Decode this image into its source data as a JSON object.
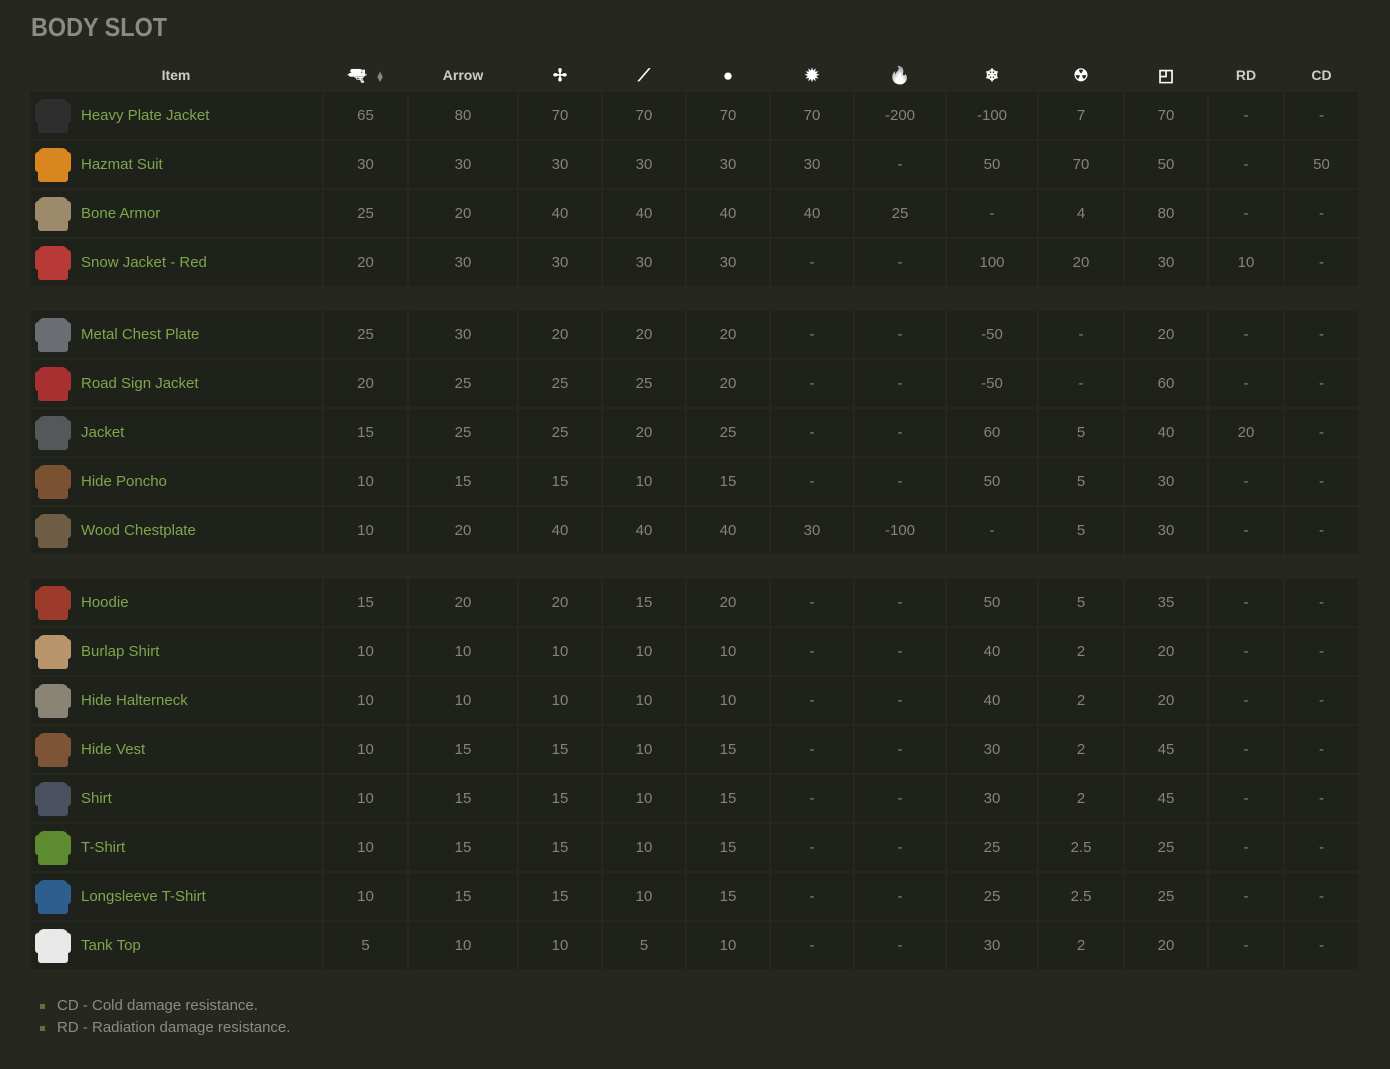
{
  "title": "BODY SLOT",
  "colors": {
    "background": "#262820",
    "cell": "#1f211b",
    "item_name": "#7ea64c",
    "value": "#85847c",
    "header": "#d0ccc4"
  },
  "columns": [
    {
      "label": "Item"
    },
    {
      "icon": "pistol-icon",
      "glyph": "🔫",
      "sortable": true
    },
    {
      "label": "Arrow"
    },
    {
      "icon": "stab-shuriken-icon",
      "glyph": "✢"
    },
    {
      "icon": "slash-knife-icon",
      "glyph": "⟋"
    },
    {
      "icon": "blunt-icon",
      "glyph": "●"
    },
    {
      "icon": "explosion-icon",
      "glyph": "✹"
    },
    {
      "icon": "fire-icon",
      "glyph": "🔥"
    },
    {
      "icon": "cold-snowflake-icon",
      "glyph": "❄"
    },
    {
      "icon": "radiation-icon",
      "glyph": "☢"
    },
    {
      "icon": "bite-icon",
      "glyph": "◰"
    },
    {
      "label": "RD"
    },
    {
      "label": "CD"
    }
  ],
  "groups": [
    [
      {
        "name": "Heavy Plate Jacket",
        "icon_color": "#2e2e2e",
        "values": [
          "65",
          "80",
          "70",
          "70",
          "70",
          "70",
          "-200",
          "-100",
          "7",
          "70",
          "-",
          "-"
        ]
      },
      {
        "name": "Hazmat Suit",
        "icon_color": "#d8861f",
        "values": [
          "30",
          "30",
          "30",
          "30",
          "30",
          "30",
          "-",
          "50",
          "70",
          "50",
          "-",
          "50"
        ]
      },
      {
        "name": "Bone Armor",
        "icon_color": "#9c8a6a",
        "values": [
          "25",
          "20",
          "40",
          "40",
          "40",
          "40",
          "25",
          "-",
          "4",
          "80",
          "-",
          "-"
        ]
      },
      {
        "name": "Snow Jacket - Red",
        "icon_color": "#b83a36",
        "values": [
          "20",
          "30",
          "30",
          "30",
          "30",
          "-",
          "-",
          "100",
          "20",
          "30",
          "10",
          "-"
        ]
      }
    ],
    [
      {
        "name": "Metal Chest Plate",
        "icon_color": "#6a6e72",
        "values": [
          "25",
          "30",
          "20",
          "20",
          "20",
          "-",
          "-",
          "-50",
          "-",
          "20",
          "-",
          "-"
        ]
      },
      {
        "name": "Road Sign Jacket",
        "icon_color": "#a83030",
        "values": [
          "20",
          "25",
          "25",
          "25",
          "20",
          "-",
          "-",
          "-50",
          "-",
          "60",
          "-",
          "-"
        ]
      },
      {
        "name": "Jacket",
        "icon_color": "#55585a",
        "values": [
          "15",
          "25",
          "25",
          "20",
          "25",
          "-",
          "-",
          "60",
          "5",
          "40",
          "20",
          "-"
        ]
      },
      {
        "name": "Hide Poncho",
        "icon_color": "#7a5232",
        "values": [
          "10",
          "15",
          "15",
          "10",
          "15",
          "-",
          "-",
          "50",
          "5",
          "30",
          "-",
          "-"
        ]
      },
      {
        "name": "Wood Chestplate",
        "icon_color": "#6e5c44",
        "values": [
          "10",
          "20",
          "40",
          "40",
          "40",
          "30",
          "-100",
          "-",
          "5",
          "30",
          "-",
          "-"
        ]
      }
    ],
    [
      {
        "name": "Hoodie",
        "icon_color": "#9c3a2c",
        "values": [
          "15",
          "20",
          "20",
          "15",
          "20",
          "-",
          "-",
          "50",
          "5",
          "35",
          "-",
          "-"
        ]
      },
      {
        "name": "Burlap Shirt",
        "icon_color": "#b8956a",
        "values": [
          "10",
          "10",
          "10",
          "10",
          "10",
          "-",
          "-",
          "40",
          "2",
          "20",
          "-",
          "-"
        ]
      },
      {
        "name": "Hide Halterneck",
        "icon_color": "#8a8474",
        "values": [
          "10",
          "10",
          "10",
          "10",
          "10",
          "-",
          "-",
          "40",
          "2",
          "20",
          "-",
          "-"
        ]
      },
      {
        "name": "Hide Vest",
        "icon_color": "#7e5436",
        "values": [
          "10",
          "15",
          "15",
          "10",
          "15",
          "-",
          "-",
          "30",
          "2",
          "45",
          "-",
          "-"
        ]
      },
      {
        "name": "Shirt",
        "icon_color": "#4a5060",
        "values": [
          "10",
          "15",
          "15",
          "10",
          "15",
          "-",
          "-",
          "30",
          "2",
          "45",
          "-",
          "-"
        ]
      },
      {
        "name": "T-Shirt",
        "icon_color": "#5e8a30",
        "values": [
          "10",
          "15",
          "15",
          "10",
          "15",
          "-",
          "-",
          "25",
          "2.5",
          "25",
          "-",
          "-"
        ]
      },
      {
        "name": "Longsleeve T-Shirt",
        "icon_color": "#2e5e8e",
        "values": [
          "10",
          "15",
          "15",
          "10",
          "15",
          "-",
          "-",
          "25",
          "2.5",
          "25",
          "-",
          "-"
        ]
      },
      {
        "name": "Tank Top",
        "icon_color": "#e8e8e8",
        "values": [
          "5",
          "10",
          "10",
          "5",
          "10",
          "-",
          "-",
          "30",
          "2",
          "20",
          "-",
          "-"
        ]
      }
    ]
  ],
  "notes": [
    "CD - Cold damage resistance.",
    "RD - Radiation damage resistance."
  ]
}
